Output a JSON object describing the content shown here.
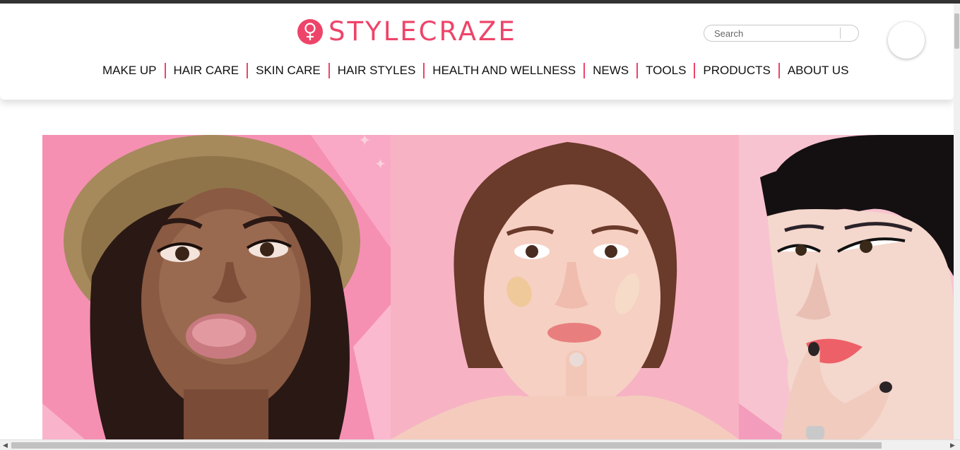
{
  "brand": {
    "name": "STYLECRAZE",
    "color": "#ee4469",
    "logo_icon": "female-symbol-icon"
  },
  "search": {
    "placeholder": "Search",
    "value": ""
  },
  "avatar": {
    "icon": "user-avatar-icon"
  },
  "nav": {
    "items": [
      "MAKE UP",
      "HAIR CARE",
      "SKIN CARE",
      "HAIR STYLES",
      "HEALTH AND WELLNESS",
      "NEWS",
      "TOOLS",
      "PRODUCTS",
      "ABOUT US"
    ],
    "separator_color": "#ee4469"
  },
  "hero": {
    "panels": [
      {
        "description_icon": "makeup-lips-photo",
        "bg": "#f28db0"
      },
      {
        "description_icon": "foundation-swatches-photo",
        "bg": "#f7b5c6"
      },
      {
        "description_icon": "eyeliner-lipstick-photo",
        "bg": "#f8c6d3"
      }
    ]
  }
}
